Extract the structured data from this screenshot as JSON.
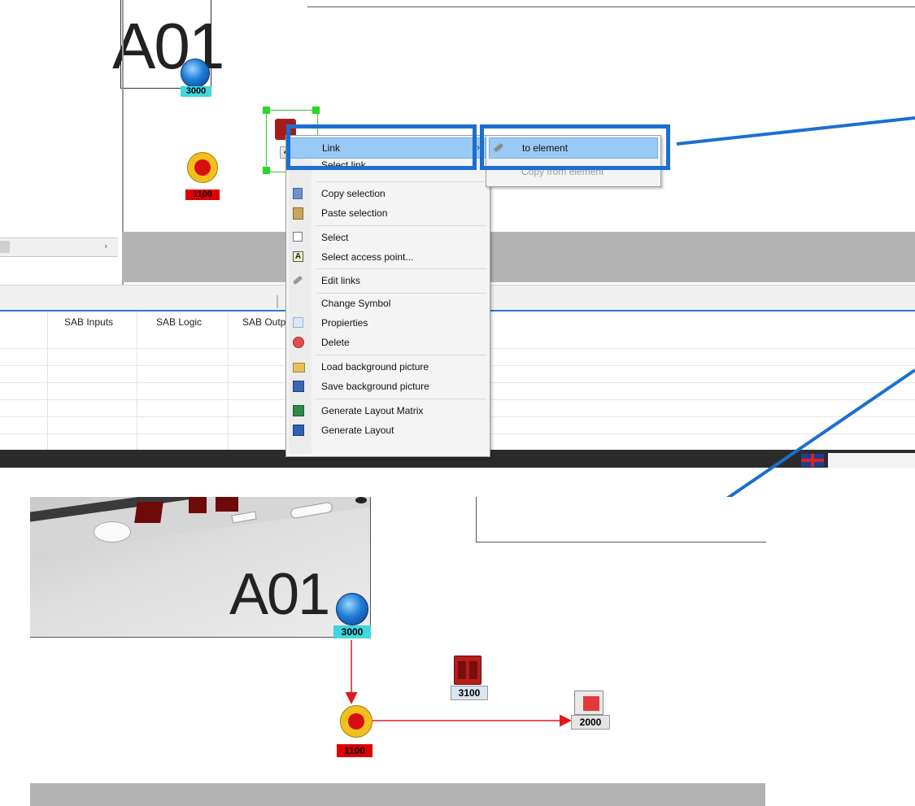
{
  "top_view": {
    "cabinet_label": "A01",
    "devices": [
      {
        "id": "3000",
        "color": "cyan"
      },
      {
        "id": "1100",
        "color": "red"
      },
      {
        "id": "4",
        "color": "gray"
      }
    ],
    "table_headers": [
      "SAB Inputs",
      "SAB Logic",
      "SAB Outp"
    ],
    "context_menu": {
      "items": [
        {
          "label": "Link",
          "icon": "link-icon",
          "has_submenu": true,
          "highlighted": true
        },
        {
          "label": "Select link...",
          "icon": "",
          "has_submenu": false
        },
        {
          "label": "Copy selection",
          "icon": "copy-icon",
          "has_submenu": false
        },
        {
          "label": "Paste selection",
          "icon": "paste-icon",
          "has_submenu": false
        },
        {
          "label": "Select",
          "icon": "select-icon",
          "has_submenu": false
        },
        {
          "label": "Select access point...",
          "icon": "access-point-icon",
          "has_submenu": false
        },
        {
          "label": "Edit links",
          "icon": "wrench-icon",
          "has_submenu": false
        },
        {
          "label": "Change Symbol",
          "icon": "",
          "has_submenu": false
        },
        {
          "label": "Propierties",
          "icon": "properties-icon",
          "has_submenu": false
        },
        {
          "label": "Delete",
          "icon": "delete-icon",
          "has_submenu": false
        },
        {
          "label": "Load background picture",
          "icon": "folder-icon",
          "has_submenu": false
        },
        {
          "label": "Save background picture",
          "icon": "save-icon",
          "has_submenu": false
        },
        {
          "label": "Generate Layout Matrix",
          "icon": "excel-icon",
          "has_submenu": false
        },
        {
          "label": "Generate Layout",
          "icon": "word-icon",
          "has_submenu": false
        }
      ],
      "submenu": [
        {
          "label": "to element",
          "icon": "link-icon",
          "highlighted": true,
          "enabled": true
        },
        {
          "label": "Copy from element",
          "icon": "",
          "highlighted": false,
          "enabled": false
        }
      ]
    }
  },
  "bottom_view": {
    "cabinet_label": "A01",
    "devices": [
      {
        "id": "3000",
        "color": "cyan"
      },
      {
        "id": "1100",
        "color": "red"
      },
      {
        "id": "3100",
        "color": "gray"
      },
      {
        "id": "2000",
        "color": "gray"
      }
    ]
  },
  "colors": {
    "highlight_box": "#1a6fd0",
    "menu_highlight": "#99c9f5",
    "link_arrow": "#e01a1a",
    "cyan_tag": "#3fd6dc",
    "red_tag": "#e00000"
  }
}
